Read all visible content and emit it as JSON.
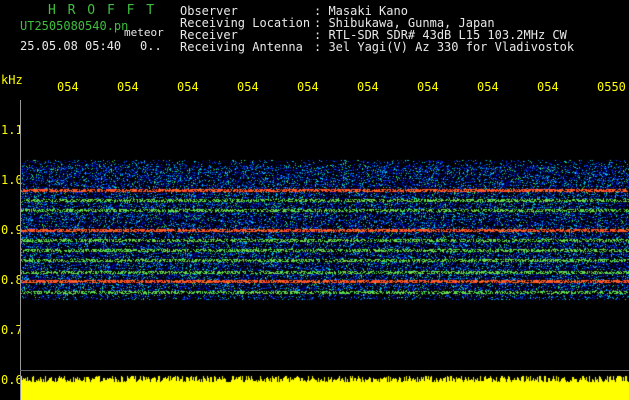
{
  "header": {
    "title": "H R O F F T",
    "filename": "UT2505080540.pn",
    "meteor_label": "meteor",
    "datetime": "25.05.08 05:40",
    "count": "0.."
  },
  "station": {
    "observer_label": "Observer",
    "observer_value": ": Masaki Kano",
    "location_label": "Receiving Location",
    "location_value": ": Shibukawa, Gunma, Japan",
    "receiver_label": "Receiver",
    "receiver_value": ": RTL-SDR SDR# 43dB L15 103.2MHz CW",
    "antenna_label": "Receiving Antenna",
    "antenna_value": ": 3el Yagi(V) Az 330 for Vladivostok"
  },
  "axes": {
    "y_unit": "kHz",
    "y_ticks": [
      "1.1",
      "1.0",
      "0.9",
      "0.8",
      "0.7",
      "0.6"
    ],
    "x_ticks": [
      "054",
      "054",
      "054",
      "054",
      "054",
      "054",
      "054",
      "054",
      "054",
      "0550"
    ]
  },
  "colors": {
    "background": "#000000",
    "text_green": "#3fbf3f",
    "tick_yellow": "#ffff00",
    "noise_yellow": "#ffff00",
    "carrier_red": "#ff3030"
  }
}
